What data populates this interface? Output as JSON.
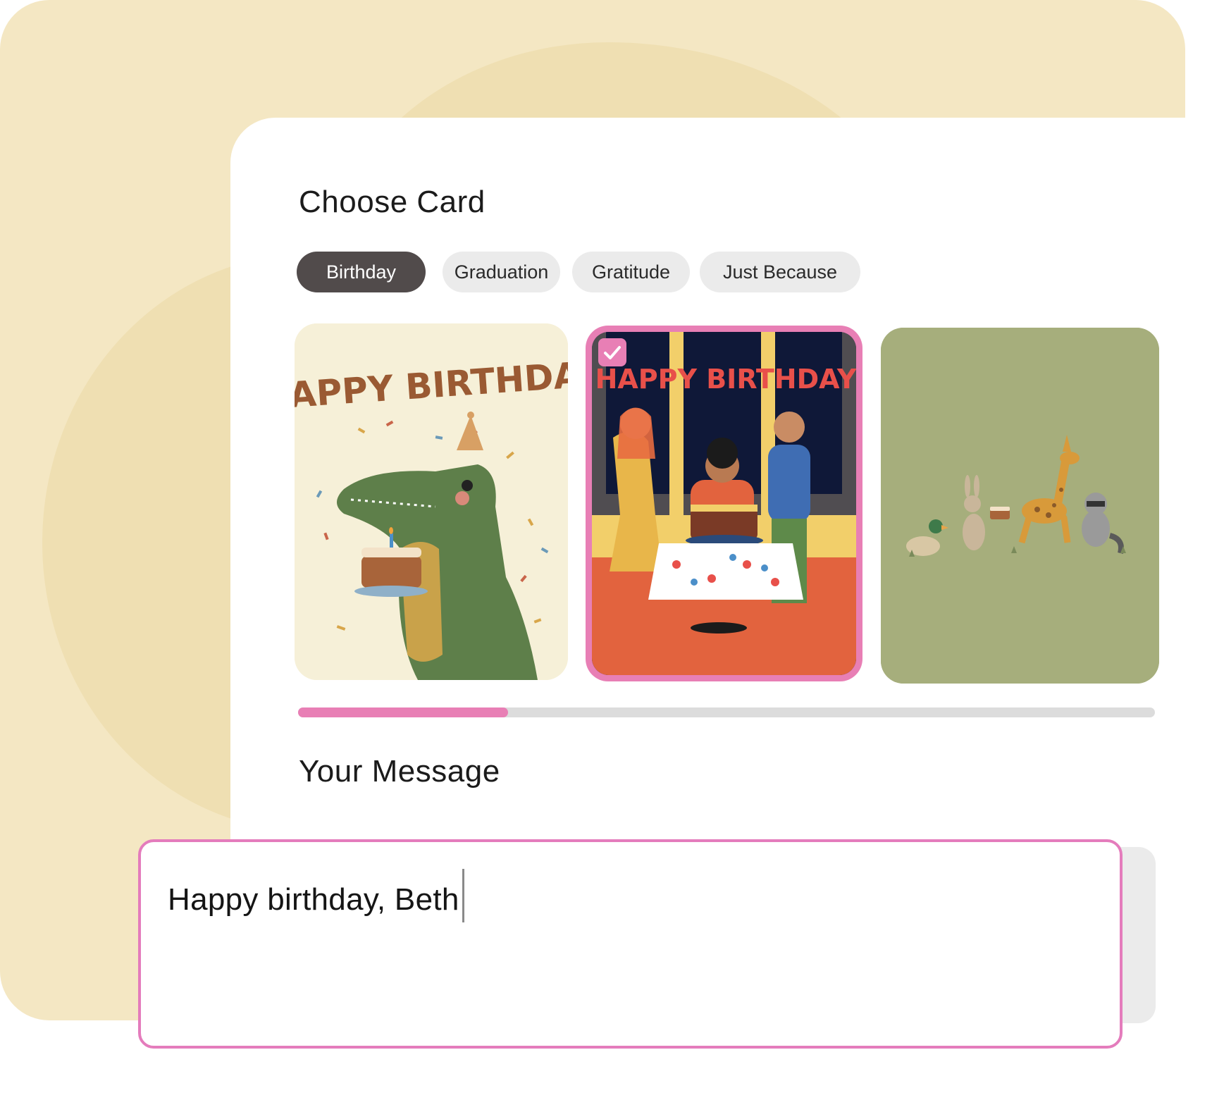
{
  "choose_card": {
    "title": "Choose Card"
  },
  "categories": [
    {
      "label": "Birthday",
      "selected": true
    },
    {
      "label": "Graduation",
      "selected": false
    },
    {
      "label": "Gratitude",
      "selected": false
    },
    {
      "label": "Just Because",
      "selected": false
    }
  ],
  "cards": [
    {
      "text": "HAPPY BIRTHDAY",
      "selected": false
    },
    {
      "text": "HAPPY BIRTHDAY",
      "selected": true
    },
    {
      "text": "",
      "selected": false
    }
  ],
  "carousel": {
    "scroll_fraction": 0.245
  },
  "message": {
    "title": "Your Message",
    "value": "Happy birthday, Beth"
  },
  "colors": {
    "accent": "#e87fb5",
    "active_tab": "#514b4b",
    "background": "#f4e7c3"
  }
}
